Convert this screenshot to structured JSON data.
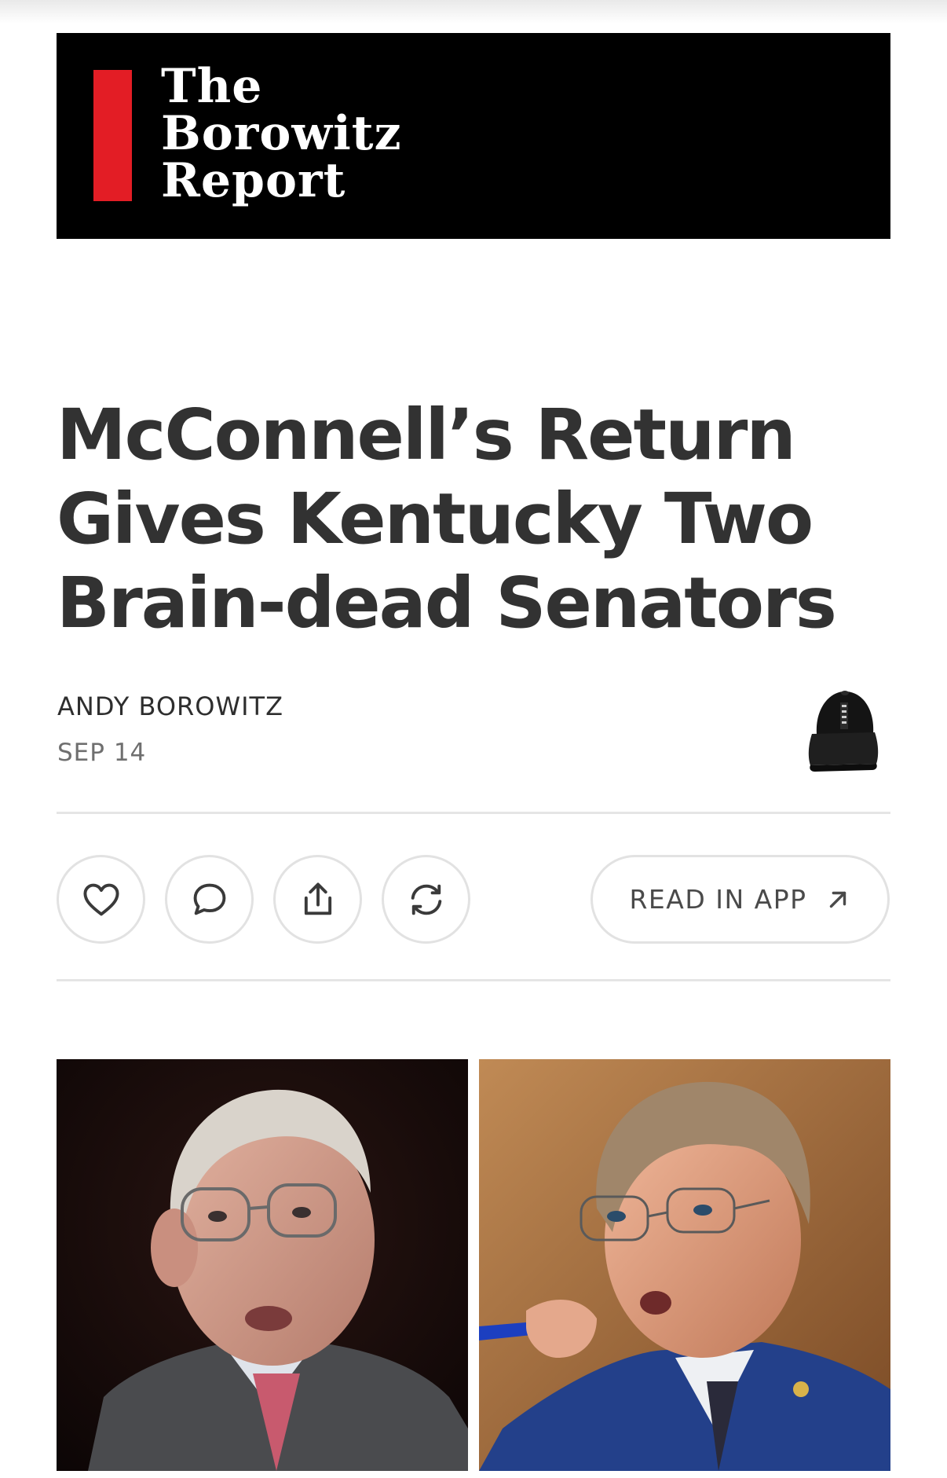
{
  "masthead": {
    "logo_lines": [
      "The",
      "Borowitz",
      "Report"
    ],
    "accent_color": "#e31d25"
  },
  "article": {
    "headline_lines": [
      "McConnell’s Return",
      "Gives Kentucky Two",
      "Brain-dead Senators"
    ],
    "author": "ANDY BOROWITZ",
    "date": "SEP 14"
  },
  "actions": {
    "icons": [
      "heart-icon",
      "comment-icon",
      "share-icon",
      "restack-icon"
    ],
    "read_in_app_label": "READ IN APP"
  },
  "images": [
    {
      "name": "photo-mcconnell"
    },
    {
      "name": "photo-rand-paul"
    }
  ]
}
